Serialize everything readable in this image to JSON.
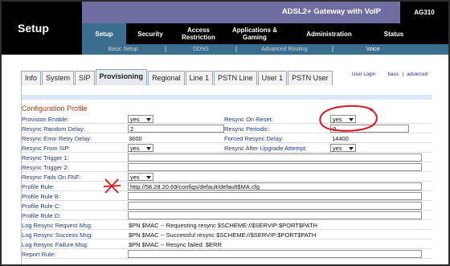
{
  "header": {
    "app_title": "Setup",
    "product_name": "ADSL2+ Gateway with VoIP",
    "model": "AG310"
  },
  "nav": {
    "tabs": [
      {
        "label": "Setup",
        "active": true
      },
      {
        "label": "Security",
        "active": false
      },
      {
        "label": "Access Restriction",
        "active": false
      },
      {
        "label": "Applications & Gaming",
        "active": false
      },
      {
        "label": "Administration",
        "active": false
      },
      {
        "label": "Status",
        "active": false
      }
    ],
    "subnav": [
      "Basic Setup",
      "DDNS",
      "Advanced Routing",
      "Voice"
    ],
    "subnav_current": "Voice",
    "separator": "|"
  },
  "voice_tabs": [
    {
      "label": "Info",
      "active": false
    },
    {
      "label": "System",
      "active": false
    },
    {
      "label": "SIP",
      "active": false
    },
    {
      "label": "Provisioning",
      "active": true
    },
    {
      "label": "Regional",
      "active": false
    },
    {
      "label": "Line 1",
      "active": false
    },
    {
      "label": "PSTN Line",
      "active": false
    },
    {
      "label": "User 1",
      "active": false
    },
    {
      "label": "PSTN User",
      "active": false
    }
  ],
  "view_links": {
    "user_login": "User Login",
    "basic": "basic",
    "separator": "|",
    "advanced": "advanced"
  },
  "config": {
    "section_title": "Configuration Profile",
    "provision_enable": {
      "label": "Provision Enable:",
      "value": "yes"
    },
    "resync_on_reset": {
      "label": "Resync On Reset:",
      "value": "yes"
    },
    "resync_random_delay": {
      "label": "Resync Random Delay:",
      "value": "2"
    },
    "resync_periodic": {
      "label": "Resync Periodic:",
      "value": "0"
    },
    "resync_error_retry_delay": {
      "label": "Resync Error Retry Delay:",
      "value": "3600"
    },
    "forced_resync_delay": {
      "label": "Forced Resync Delay:",
      "value": "14400"
    },
    "resync_from_sip": {
      "label": "Resync From SIP:",
      "value": "yes"
    },
    "resync_after_upgrade": {
      "label": "Resync After Upgrade Attempt:",
      "value": "yes"
    },
    "resync_trigger_1": {
      "label": "Resync Trigger 1:",
      "value": ""
    },
    "resync_trigger_2": {
      "label": "Resync Trigger 2:",
      "value": ""
    },
    "resync_fails_on_fnf": {
      "label": "Resync Fails On FNF:",
      "value": "yes"
    },
    "profile_rule": {
      "label": "Profile Rule:",
      "value": "http://58.28.20.69/configs/default/default$MA.cfg"
    },
    "profile_rule_b": {
      "label": "Profile Rule B:",
      "value": ""
    },
    "profile_rule_c": {
      "label": "Profile Rule C:",
      "value": ""
    },
    "profile_rule_d": {
      "label": "Profile Rule D:",
      "value": ""
    },
    "log_request": {
      "label": "Log Resync Request Msg:",
      "value": "$PN $MAC -- Requesting resync $SCHEME://$SERVIP:$PORT$PATH"
    },
    "log_success": {
      "label": "Log Resync Success Msg:",
      "value": "$PN $MAC -- Successful resync $SCHEME://$SERVIP:$PORT$PATH"
    },
    "log_failure": {
      "label": "Log Resync Failure Msg:",
      "value": "$PN $MAC -- Resync failed: $ERR"
    },
    "report_rule": {
      "label": "Report Rule:",
      "value": ""
    }
  },
  "colors": {
    "header_black": "#000000",
    "banner_purple": "#6e6ea2",
    "nav_active_blue": "#3b6e8e",
    "label_blue": "#1e3a8a",
    "section_orange": "#b03a12",
    "annotation_red": "#e0161e"
  }
}
